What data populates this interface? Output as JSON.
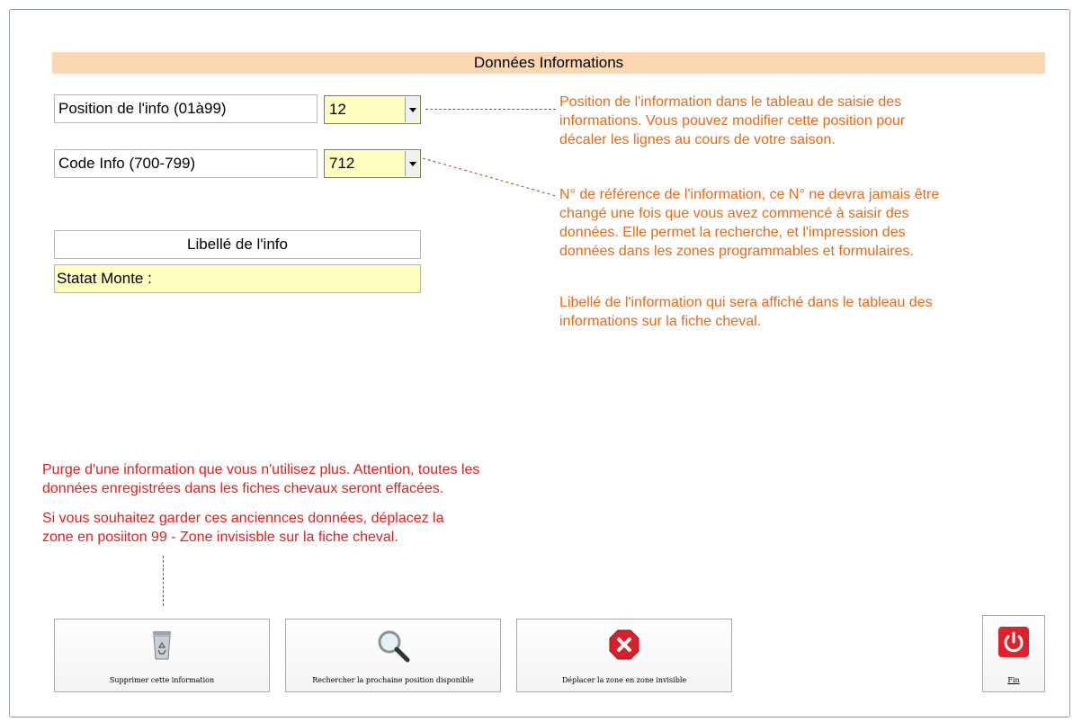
{
  "header": {
    "title": "Données Informations"
  },
  "position": {
    "label": "Position de l'info (01à99)",
    "value": "12"
  },
  "code": {
    "label": "Code Info (700-799)",
    "value": "712"
  },
  "libelle": {
    "label": "Libellé de l'info",
    "value": "Statat Monte :"
  },
  "notes": {
    "position": [
      "Position de l'information dans le tableau de saisie des",
      "informations. Vous pouvez modifier cette position pour",
      "décaler les lignes au cours de votre saison."
    ],
    "code": [
      "N° de référence de l'information, ce N° ne devra jamais être",
      "changé une fois que vous avez commencé à saisir des",
      "données. Elle permet la recherche, et l'impression des",
      "données dans les zones programmables et formulaires."
    ],
    "libelle": [
      "Libellé de l'information qui sera affiché dans le tableau des",
      "informations sur la fiche cheval."
    ],
    "purge": [
      "Purge d'une information que vous n'utilisez plus. Attention, toutes les",
      "données enregistrées dans les fiches chevaux seront effacées."
    ],
    "keep": [
      "Si vous souhaitez garder ces anciennces données, déplacez la",
      "zone en posiiton 99 - Zone invisisble sur la fiche cheval."
    ]
  },
  "buttons": {
    "delete": "Supprimer cette information",
    "search": "Rechercher la prochaine position disponible",
    "move": "Déplacer la zone en zone invisible",
    "end": "Fin"
  },
  "icons": {
    "delete": "recycle-bin-icon",
    "search": "magnifier-icon",
    "move": "red-x-icon",
    "end": "power-icon"
  },
  "colors": {
    "header_bg": "#fbd7b2",
    "input_bg": "#ffffc0",
    "note_orange": "#e86a17",
    "note_red": "#e02020"
  }
}
